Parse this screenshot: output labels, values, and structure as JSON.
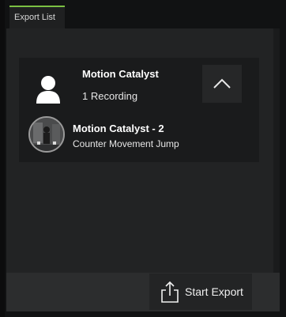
{
  "tab": {
    "label": "Export List",
    "accent_color": "#7bc043"
  },
  "group": {
    "title": "Motion Catalyst",
    "count_label": "1 Recording",
    "icon": "user-icon",
    "collapse_icon": "chevron-up-icon"
  },
  "recordings": [
    {
      "title": "Motion Catalyst - 2",
      "subtitle": "Counter Movement Jump",
      "thumbnail_icon": "recording-thumbnail"
    }
  ],
  "footer": {
    "export_label": "Start Export",
    "export_icon": "share-export-icon"
  }
}
